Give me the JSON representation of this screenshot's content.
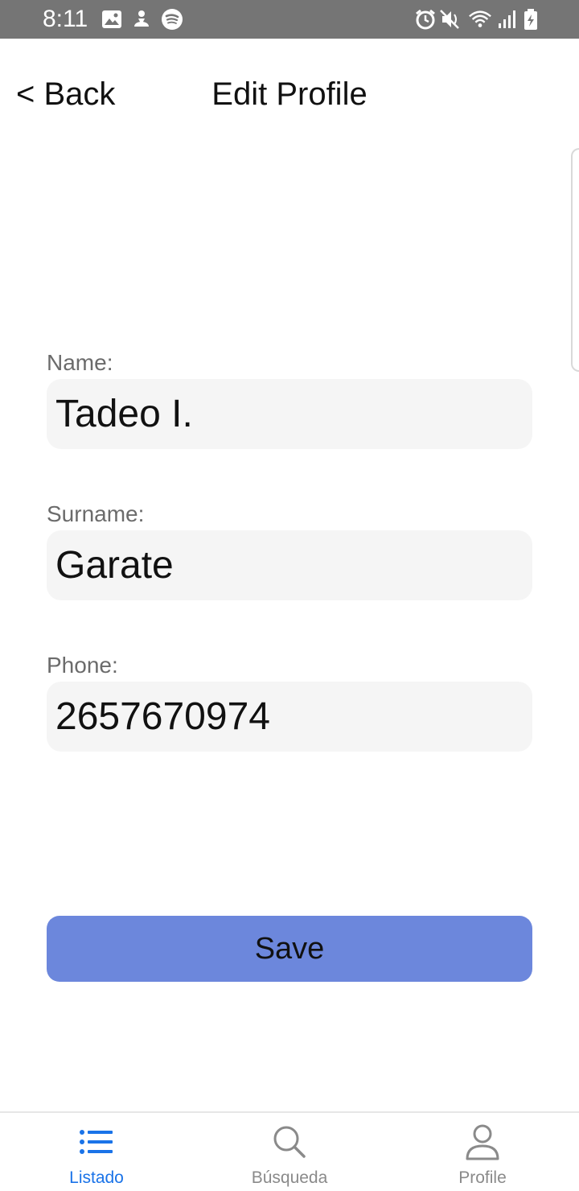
{
  "status_bar": {
    "time": "8:11",
    "left_icons": [
      "image-icon",
      "game-icon",
      "spotify-icon"
    ],
    "right_icons": [
      "alarm-icon",
      "mute-icon",
      "wifi-icon",
      "signal-icon",
      "battery-icon"
    ],
    "background": "#757575"
  },
  "header": {
    "back_label": "< Back",
    "title": "Edit Profile"
  },
  "form": {
    "name_label": "Name:",
    "name_value": "Tadeo I.",
    "surname_label": "Surname:",
    "surname_value": "Garate",
    "phone_label": "Phone:",
    "phone_value": "2657670974",
    "save_label": "Save",
    "save_color": "#6c87dc",
    "input_bg": "#f5f5f5"
  },
  "bottom_nav": {
    "items": [
      {
        "label": "Listado",
        "icon": "list-icon",
        "active": true
      },
      {
        "label": "Búsqueda",
        "icon": "search-icon",
        "active": false
      },
      {
        "label": "Profile",
        "icon": "user-icon",
        "active": false
      }
    ],
    "active_color": "#1a73e8",
    "inactive_color": "#8a8a8a"
  }
}
